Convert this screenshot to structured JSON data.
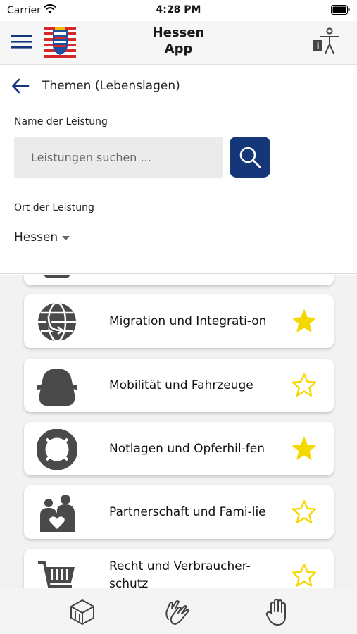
{
  "status": {
    "carrier": "Carrier",
    "time": "4:28 PM"
  },
  "header": {
    "title_line1": "Hessen",
    "title_line2": "App",
    "menu_icon": "hamburger-menu-icon",
    "accessibility_icon": "accessibility-info-icon"
  },
  "nav": {
    "back_label": "Themen (Lebenslagen)"
  },
  "search": {
    "name_label": "Name der Leistung",
    "placeholder": "Leistungen suchen ...",
    "location_label": "Ort der Leistung",
    "location_value": "Hessen"
  },
  "topics": [
    {
      "title": "",
      "icon": "partial-icon",
      "favorite": false
    },
    {
      "title": "Migration und Integrati-on",
      "icon": "globe-icon",
      "favorite": true
    },
    {
      "title": "Mobilität und Fahrzeuge",
      "icon": "car-icon",
      "favorite": false
    },
    {
      "title": "Notlagen und Opferhil-fen",
      "icon": "lifebuoy-icon",
      "favorite": true
    },
    {
      "title": "Partnerschaft und Fami-lie",
      "icon": "family-icon",
      "favorite": false
    },
    {
      "title": "Recht und Verbraucher-schutz",
      "icon": "basket-icon",
      "favorite": false
    }
  ],
  "tabs": [
    {
      "icon": "stack-layers-icon"
    },
    {
      "icon": "hands-icon"
    },
    {
      "icon": "hand-icon"
    }
  ],
  "colors": {
    "accent": "#15377a",
    "star": "#f5d800",
    "icon_gray": "#4a4a4a"
  }
}
